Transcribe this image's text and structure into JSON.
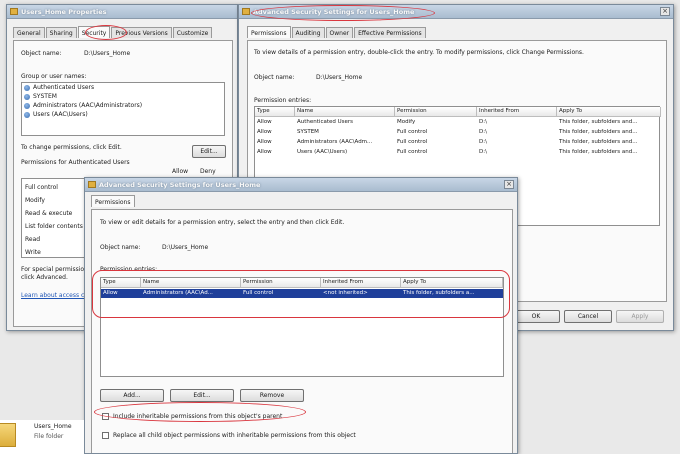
{
  "properties_window": {
    "title": "Users_Home Properties",
    "tabs": [
      "General",
      "Sharing",
      "Security",
      "Previous Versions",
      "Customize"
    ],
    "active_tab": "Security",
    "object_name_label": "Object name:",
    "object_name_value": "D:\\Users_Home",
    "group_label": "Group or user names:",
    "principals": [
      {
        "name": "Authenticated Users"
      },
      {
        "name": "SYSTEM"
      },
      {
        "name": "Administrators (AAC\\Administrators)"
      },
      {
        "name": "Users (AAC\\Users)"
      }
    ],
    "change_text": "To change permissions, click Edit.",
    "edit_button": "Edit...",
    "permissions_for_label": "Permissions for Authenticated Users",
    "allow_col": "Allow",
    "deny_col": "Deny",
    "permissions": [
      "Full control",
      "Modify",
      "Read & execute",
      "List folder contents",
      "Read",
      "Write"
    ],
    "special_text_1": "For special permissions or advanced settings,",
    "special_text_2": "click Advanced.",
    "learn_link": "Learn about access control and permissions"
  },
  "advanced_window_back": {
    "title": "Advanced Security Settings for Users_Home",
    "tabs": [
      "Permissions",
      "Auditing",
      "Owner",
      "Effective Permissions"
    ],
    "active_tab": "Permissions",
    "intro": "To view details of a permission entry, double-click the entry. To modify permissions, click Change Permissions.",
    "object_name_label": "Object name:",
    "object_name_value": "D:\\Users_Home",
    "entries_label": "Permission entries:",
    "columns": [
      "Type",
      "Name",
      "Permission",
      "Inherited From",
      "Apply To"
    ],
    "rows": [
      [
        "Allow",
        "Authenticated Users",
        "Modify",
        "D:\\",
        "This folder, subfolders and..."
      ],
      [
        "Allow",
        "SYSTEM",
        "Full control",
        "D:\\",
        "This folder, subfolders and..."
      ],
      [
        "Allow",
        "Administrators (AAC\\Adm...",
        "Full control",
        "D:\\",
        "This folder, subfolders and..."
      ],
      [
        "Allow",
        "Users (AAC\\Users)",
        "Full control",
        "D:\\",
        "This folder, subfolders and..."
      ]
    ],
    "ok_button": "OK",
    "cancel_button": "Cancel",
    "apply_button": "Apply"
  },
  "advanced_window_front": {
    "title": "Advanced Security Settings for Users_Home",
    "tab": "Permissions",
    "intro": "To view or edit details for a permission entry, select the entry and then click Edit.",
    "object_name_label": "Object name:",
    "object_name_value": "D:\\Users_Home",
    "entries_label": "Permission entries:",
    "columns": [
      "Type",
      "Name",
      "Permission",
      "Inherited From",
      "Apply To"
    ],
    "rows": [
      [
        "Allow",
        "Administrators (AAC\\Ad...",
        "Full control",
        "<not inherited>",
        "This folder, subfolders a..."
      ]
    ],
    "add_button": "Add...",
    "edit_button": "Edit...",
    "remove_button": "Remove",
    "include_inheritable": "Include inheritable permissions from this object's parent",
    "replace_child": "Replace all child object permissions with inheritable permissions from this object"
  },
  "explorer_item": {
    "name": "Users_Home",
    "type": "File folder"
  },
  "icons": {
    "principal": "user-group-icon",
    "folder": "folder-icon",
    "close": "close-icon"
  }
}
